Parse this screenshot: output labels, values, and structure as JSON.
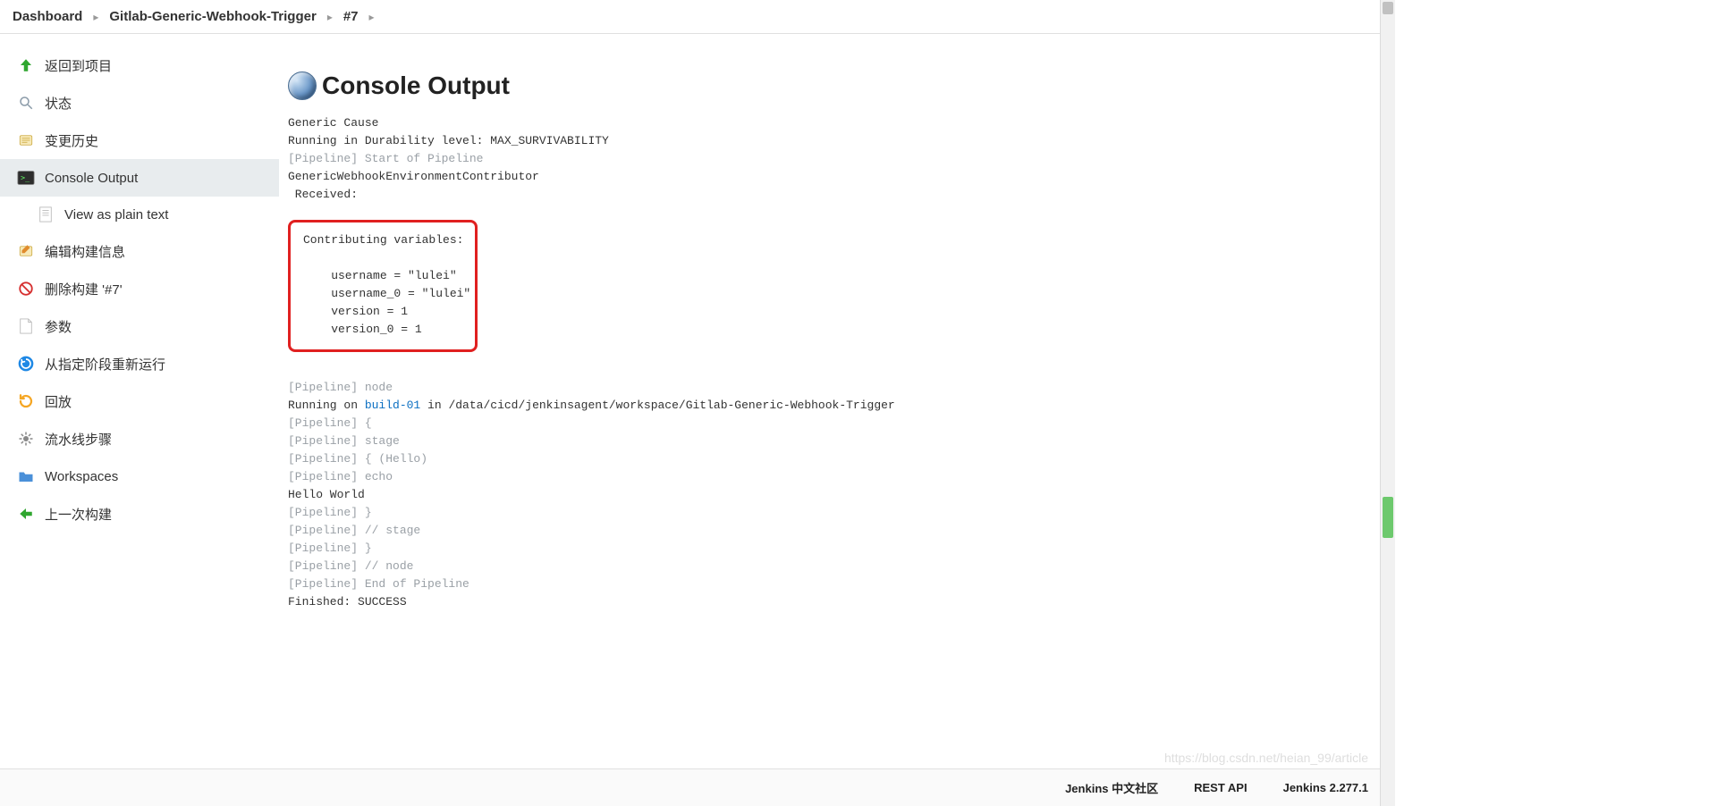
{
  "breadcrumbs": [
    {
      "label": "Dashboard"
    },
    {
      "label": "Gitlab-Generic-Webhook-Trigger"
    },
    {
      "label": "#7"
    }
  ],
  "sidebar": {
    "items": [
      {
        "id": "back",
        "label": "返回到项目",
        "icon": "up-arrow-icon"
      },
      {
        "id": "status",
        "label": "状态",
        "icon": "search-icon"
      },
      {
        "id": "changes",
        "label": "变更历史",
        "icon": "notes-icon"
      },
      {
        "id": "console",
        "label": "Console Output",
        "icon": "terminal-icon",
        "active": true
      },
      {
        "id": "plaintext",
        "label": "View as plain text",
        "icon": "document-icon",
        "sub": true
      },
      {
        "id": "editbuild",
        "label": "编辑构建信息",
        "icon": "notes-icon"
      },
      {
        "id": "deletebuild",
        "label": "删除构建 '#7'",
        "icon": "no-entry-icon"
      },
      {
        "id": "params",
        "label": "参数",
        "icon": "page-icon"
      },
      {
        "id": "restart",
        "label": "从指定阶段重新运行",
        "icon": "restart-icon"
      },
      {
        "id": "replay",
        "label": "回放",
        "icon": "redo-icon"
      },
      {
        "id": "steps",
        "label": "流水线步骤",
        "icon": "gear-icon"
      },
      {
        "id": "workspaces",
        "label": "Workspaces",
        "icon": "folder-icon"
      },
      {
        "id": "prevbuild",
        "label": "上一次构建",
        "icon": "left-arrow-icon"
      }
    ]
  },
  "main": {
    "title": "Console Output",
    "pre1_line1": "Generic Cause",
    "pre1_line2": "Running in Durability level: MAX_SURVIVABILITY",
    "pre1_line3_dim": "[Pipeline] Start of Pipeline",
    "pre1_line4": "GenericWebhookEnvironmentContributor",
    "pre1_line5": " Received:",
    "box_line1": "Contributing variables:",
    "box_line3": "    username = \"lulei\"",
    "box_line4": "    username_0 = \"lulei\"",
    "box_line5": "    version = 1",
    "box_line6": "    version_0 = 1",
    "pre2_l1_dim": "[Pipeline] node",
    "pre2_l2a": "Running on ",
    "pre2_l2b_link": "build-01",
    "pre2_l2c": " in /data/cicd/jenkinsagent/workspace/Gitlab-Generic-Webhook-Trigger",
    "pre2_l3_dim": "[Pipeline] {",
    "pre2_l4_dim": "[Pipeline] stage",
    "pre2_l5_dim": "[Pipeline] { (Hello)",
    "pre2_l6_dim": "[Pipeline] echo",
    "pre2_l7": "Hello World",
    "pre2_l8_dim": "[Pipeline] }",
    "pre2_l9_dim": "[Pipeline] // stage",
    "pre2_l10_dim": "[Pipeline] }",
    "pre2_l11_dim": "[Pipeline] // node",
    "pre2_l12_dim": "[Pipeline] End of Pipeline",
    "pre2_l13": "Finished: SUCCESS"
  },
  "footer": {
    "community": "Jenkins 中文社区",
    "restapi": "REST API",
    "version": "Jenkins 2.277.1"
  },
  "watermark": "https://blog.csdn.net/heian_99/article"
}
